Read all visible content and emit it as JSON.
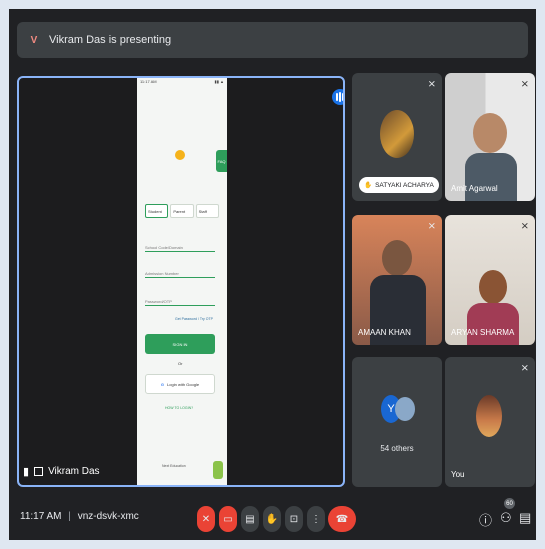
{
  "banner": {
    "avatar_letter": "V",
    "text": "Vikram Das is presenting"
  },
  "presenter": {
    "name": "Vikram Das"
  },
  "shared_screen": {
    "status_left": "11:17 AM",
    "faq": "FAQ",
    "roles": [
      "Student",
      "Parent",
      "Staff"
    ],
    "school_code_placeholder": "School Code/Domain",
    "admission_placeholder": "Admission Number",
    "password_placeholder": "Password/OTP",
    "forgot": "Get Password / Try OTP",
    "signin": "SIGN IN",
    "or": "Or",
    "google": "Login with Google",
    "howto": "HOW TO LOGIN?",
    "powered": "Next Education"
  },
  "participants": [
    {
      "name": "SATYAKI ACHARYA"
    },
    {
      "name": "Amit Agarwal"
    },
    {
      "name": "AMAAN KHAN"
    },
    {
      "name": "ARYAN SHARMA"
    },
    {
      "name": "54 others",
      "initial": "Y"
    },
    {
      "name": "You"
    }
  ],
  "bottom_bar": {
    "time": "11:17 AM",
    "separator": "|",
    "meeting_code": "vnz-dsvk-xmc",
    "participant_count": "60"
  },
  "colors": {
    "accent": "#8ab4f8",
    "danger": "#ea4335",
    "tile_bg": "#3c4043",
    "bg": "#202124"
  }
}
